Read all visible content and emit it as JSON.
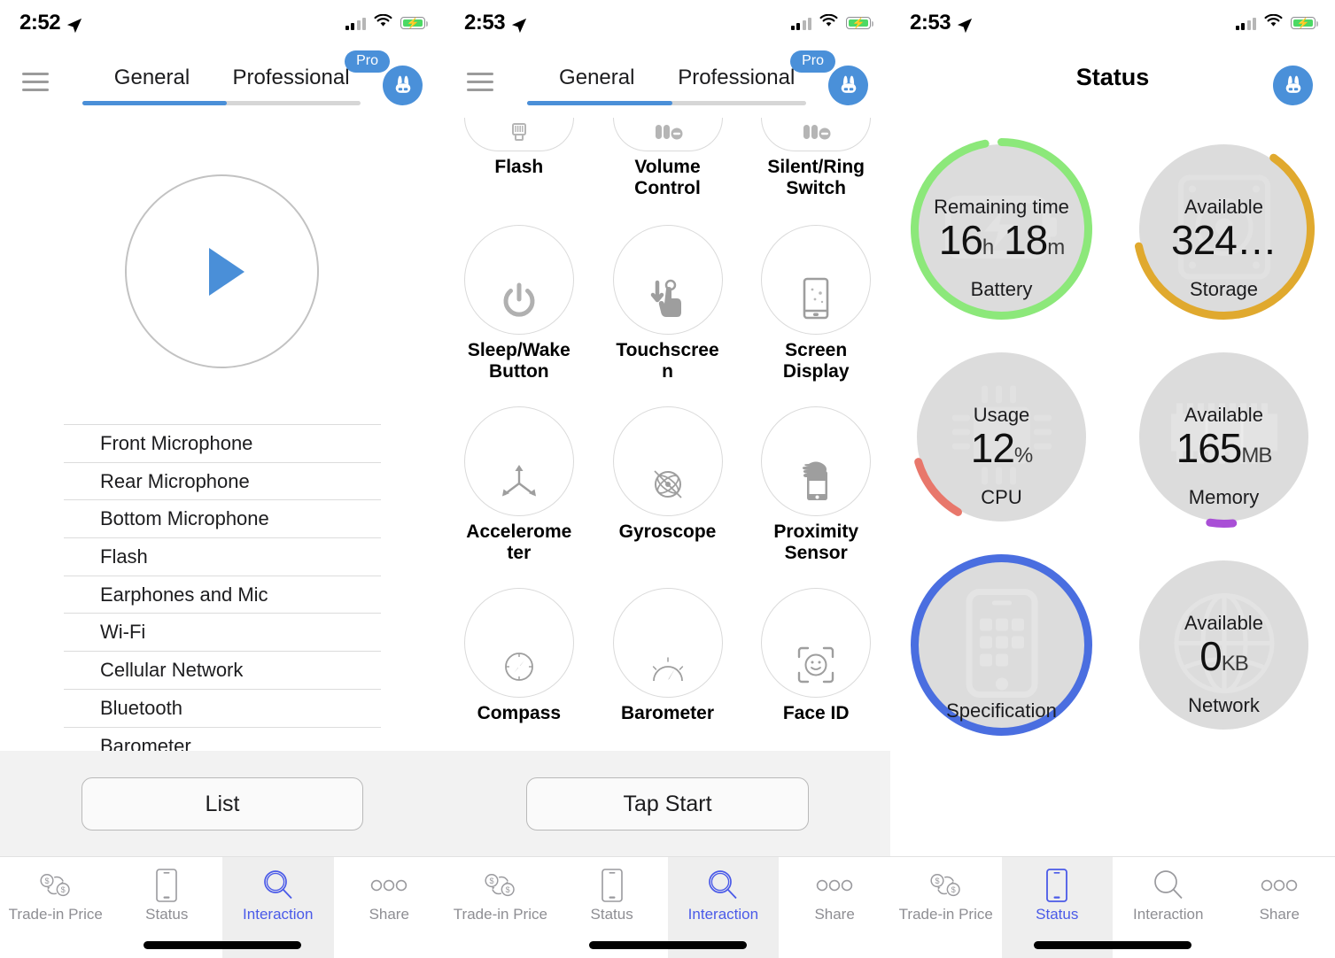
{
  "colors": {
    "accent_blue": "#4a90d9",
    "tab_active": "#4a5ae8",
    "battery_ring": "#8ce87a",
    "storage_ring": "#e0a92e",
    "cpu_ring": "#e8776b",
    "memory_ring": "#a94fd6",
    "spec_ring": "#4a6ee0",
    "track_gray": "#d6d6d6"
  },
  "panel1": {
    "statusbar": {
      "time": "2:52",
      "location_icon": "location-arrow",
      "signal_icon": "cellular-signal",
      "wifi_icon": "wifi",
      "battery_icon": "battery-charging"
    },
    "header": {
      "menu_icon": "hamburger-menu",
      "tabs": [
        {
          "label": "General",
          "active": true
        },
        {
          "label": "Professional",
          "active": false
        }
      ],
      "pro_badge": "Pro",
      "logo_icon": "rabbit-logo"
    },
    "play_button": {
      "icon": "play-triangle"
    },
    "list_items": [
      "Front Microphone",
      "Rear Microphone",
      "Bottom Microphone",
      "Flash",
      "Earphones and Mic",
      "Wi-Fi",
      "Cellular Network",
      "Bluetooth",
      "Barometer"
    ],
    "action_button": "List",
    "tabbar": [
      {
        "label": "Trade-in Price",
        "icon": "trade-in-price-icon",
        "active": false
      },
      {
        "label": "Status",
        "icon": "phone-icon",
        "active": false
      },
      {
        "label": "Interaction",
        "icon": "magnifier-icon",
        "active": true
      },
      {
        "label": "Share",
        "icon": "ellipsis-icon",
        "active": false
      }
    ]
  },
  "panel2": {
    "statusbar": {
      "time": "2:53",
      "location_icon": "location-arrow",
      "signal_icon": "cellular-signal",
      "wifi_icon": "wifi",
      "battery_icon": "battery-charging"
    },
    "header": {
      "menu_icon": "hamburger-menu",
      "tabs": [
        {
          "label": "General",
          "active": true
        },
        {
          "label": "Professional",
          "active": false
        }
      ],
      "pro_badge": "Pro",
      "logo_icon": "rabbit-logo"
    },
    "grid": [
      [
        {
          "label": "Flash",
          "icon": "flash-icon"
        },
        {
          "label": "Volume Control",
          "icon": "volume-buttons-icon"
        },
        {
          "label": "Silent/Ring Switch",
          "icon": "ring-switch-icon"
        }
      ],
      [
        {
          "label": "Sleep/Wake Button",
          "icon": "power-icon"
        },
        {
          "label": "Touchscreen",
          "icon": "touch-hand-icon"
        },
        {
          "label": "Screen Display",
          "icon": "screen-display-icon"
        }
      ],
      [
        {
          "label": "Accelerometer",
          "icon": "accelerometer-axes-icon"
        },
        {
          "label": "Gyroscope",
          "icon": "gyroscope-icon"
        },
        {
          "label": "Proximity Sensor",
          "icon": "proximity-sensor-icon"
        }
      ],
      [
        {
          "label": "Compass",
          "icon": "compass-icon"
        },
        {
          "label": "Barometer",
          "icon": "barometer-gauge-icon"
        },
        {
          "label": "Face ID",
          "icon": "face-id-icon"
        }
      ]
    ],
    "action_button": "Tap Start",
    "tabbar": [
      {
        "label": "Trade-in Price",
        "icon": "trade-in-price-icon",
        "active": false
      },
      {
        "label": "Status",
        "icon": "phone-icon",
        "active": false
      },
      {
        "label": "Interaction",
        "icon": "magnifier-icon",
        "active": true
      },
      {
        "label": "Share",
        "icon": "ellipsis-icon",
        "active": false
      }
    ]
  },
  "panel3": {
    "statusbar": {
      "time": "2:53",
      "location_icon": "location-arrow",
      "signal_icon": "cellular-signal",
      "wifi_icon": "wifi",
      "battery_icon": "battery-charging"
    },
    "title": "Status",
    "logo_icon": "rabbit-logo",
    "dials": [
      {
        "top": "Remaining time",
        "value": "16",
        "unit": "h",
        "value2": "18",
        "unit2": "m",
        "bottom": "Battery",
        "ring_color": "#8ce87a",
        "ring_pct": 97,
        "bg_icon": "battery-icon"
      },
      {
        "top": "Available",
        "value": "324",
        "unit": "…",
        "bottom": "Storage",
        "ring_color": "#e0a92e",
        "ring_pct": 62,
        "bg_icon": "hard-drive-icon"
      },
      {
        "top": "Usage",
        "value": "12",
        "unit": "%",
        "bottom": "CPU",
        "ring_color": "#e8776b",
        "ring_pct": 12,
        "bg_icon": "cpu-chip-icon"
      },
      {
        "top": "Available",
        "value": "165",
        "unit": "MB",
        "bottom": "Memory",
        "ring_color": "#a94fd6",
        "ring_pct": 4,
        "bg_icon": "memory-stick-icon"
      },
      {
        "top": "",
        "value": "",
        "unit": "",
        "bottom": "Specification",
        "ring_color": "#4a6ee0",
        "ring_pct": 100,
        "bg_icon": "phone-grid-icon"
      },
      {
        "top": "Available",
        "value": "0",
        "unit": "KB",
        "bottom": "Network",
        "ring_color": "#dcdcdc",
        "ring_pct": 0,
        "bg_icon": "globe-icon"
      }
    ],
    "tabbar": [
      {
        "label": "Trade-in Price",
        "icon": "trade-in-price-icon",
        "active": false
      },
      {
        "label": "Status",
        "icon": "phone-icon",
        "active": true
      },
      {
        "label": "Interaction",
        "icon": "magnifier-icon",
        "active": false
      },
      {
        "label": "Share",
        "icon": "ellipsis-icon",
        "active": false
      }
    ]
  }
}
